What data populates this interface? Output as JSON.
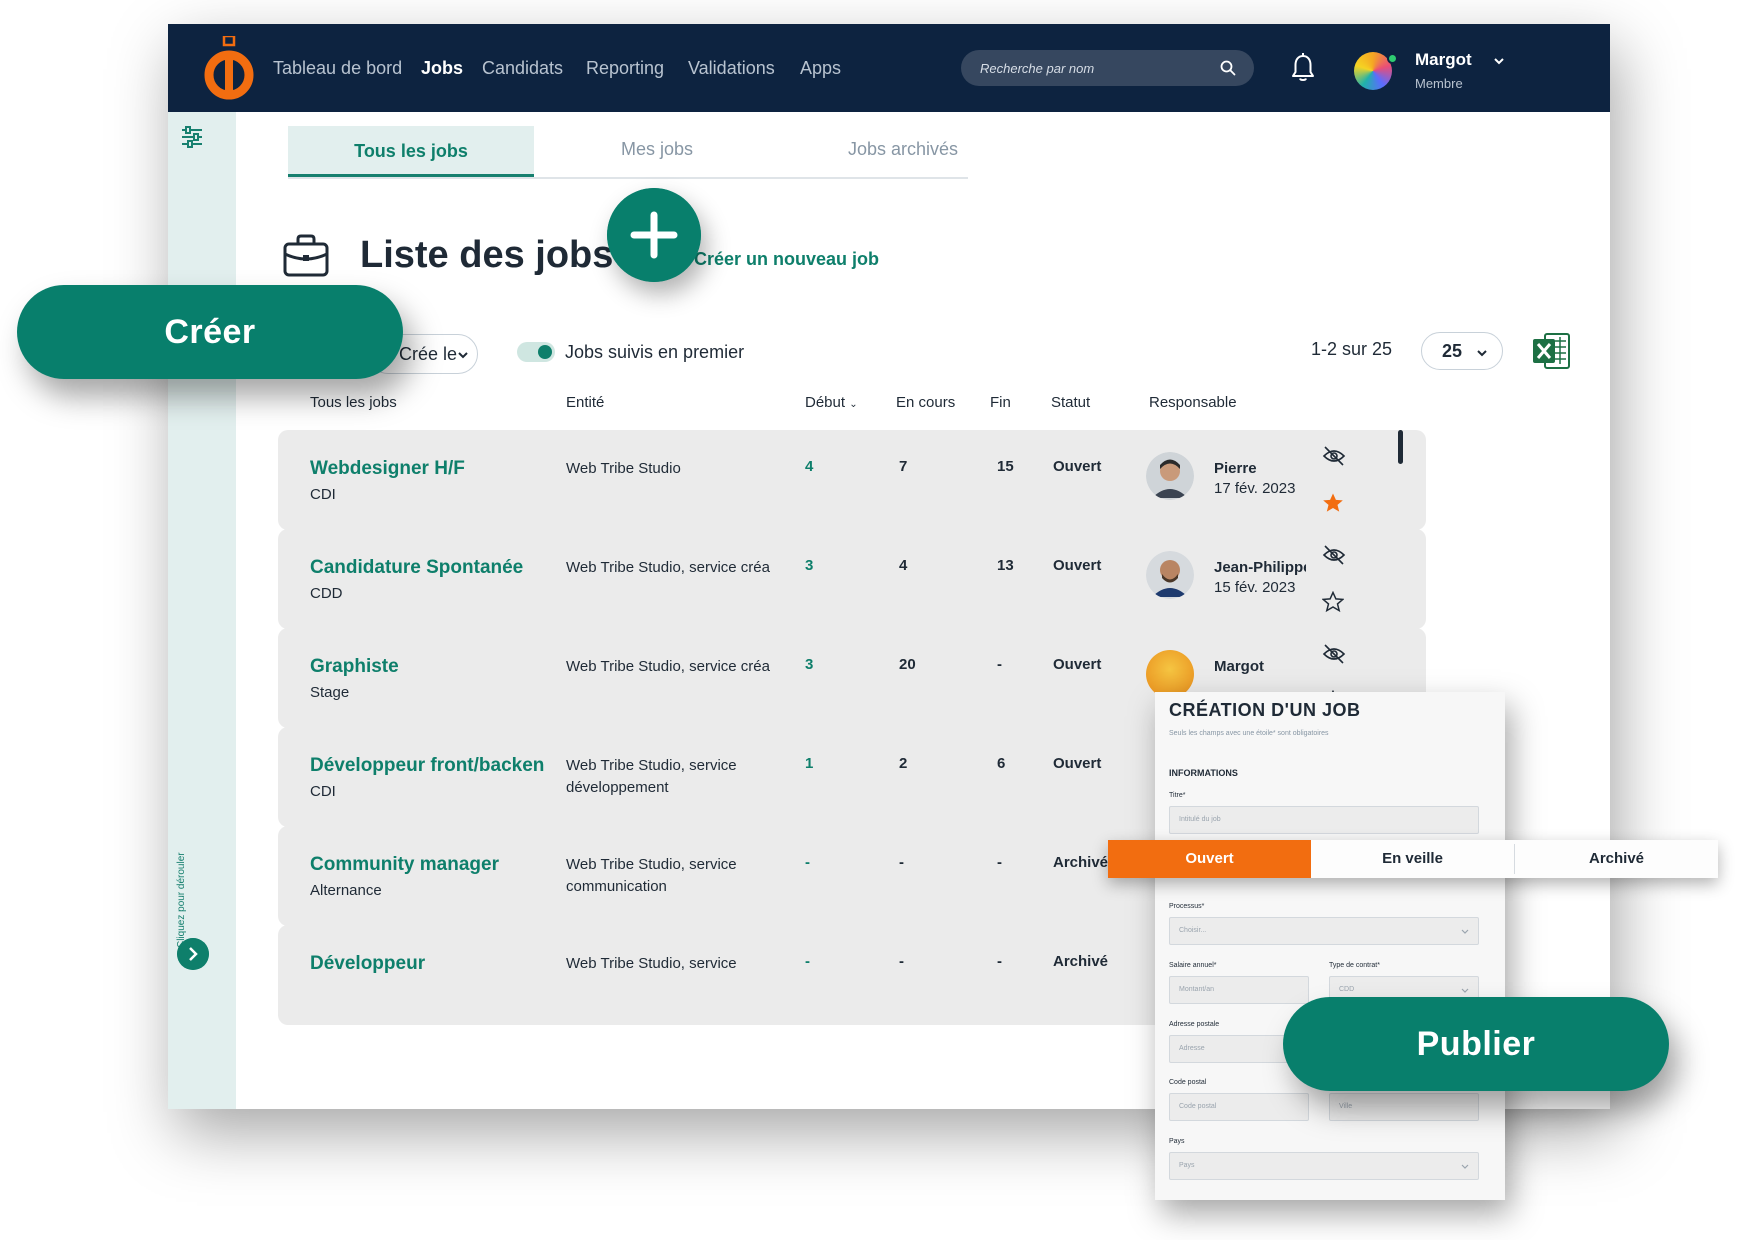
{
  "nav": {
    "items": [
      "Tableau de bord",
      "Jobs",
      "Candidats",
      "Reporting",
      "Validations",
      "Apps"
    ],
    "active": "Jobs"
  },
  "search": {
    "placeholder": "Recherche par nom"
  },
  "user": {
    "name": "Margot",
    "role": "Membre"
  },
  "tabs": [
    "Tous les jobs",
    "Mes jobs",
    "Jobs archivés"
  ],
  "page": {
    "title": "Liste des jobs",
    "create_link": "Créer un nouveau job"
  },
  "filters": {
    "sort_label": "Crée le",
    "toggle_label": "Jobs suivis en premier",
    "pagination": "1-2 sur 25",
    "per_page": "25"
  },
  "table": {
    "headers": {
      "all": "Tous les jobs",
      "entity": "Entité",
      "start": "Début",
      "ongoing": "En cours",
      "end": "Fin",
      "status": "Statut",
      "owner": "Responsable"
    },
    "rows": [
      {
        "title": "Webdesigner H/F",
        "contract": "CDI",
        "entity": "Web Tribe Studio",
        "start": "4",
        "ongoing": "7",
        "end": "15",
        "status": "Ouvert",
        "owner": "Pierre",
        "date": "17 fév. 2023",
        "followed": true
      },
      {
        "title": "Candidature Spontanée",
        "contract": "CDD",
        "entity": "Web Tribe Studio, service créa",
        "start": "3",
        "ongoing": "4",
        "end": "13",
        "status": "Ouvert",
        "owner": "Jean-Philippe",
        "date": "15 fév. 2023",
        "followed": false
      },
      {
        "title": "Graphiste",
        "contract": "Stage",
        "entity": "Web Tribe Studio, service créa",
        "start": "3",
        "ongoing": "20",
        "end": "-",
        "status": "Ouvert",
        "owner": "Margot",
        "date": "",
        "followed": false
      },
      {
        "title": "Développeur front/backen",
        "contract": "CDI",
        "entity": "Web Tribe Studio, service développement",
        "start": "1",
        "ongoing": "2",
        "end": "6",
        "status": "Ouvert",
        "owner": "",
        "date": "",
        "followed": false
      },
      {
        "title": "Community manager",
        "contract": "Alternance",
        "entity": "Web Tribe Studio, service communication",
        "start": "-",
        "ongoing": "-",
        "end": "-",
        "status": "Archivé",
        "owner": "",
        "date": "",
        "followed": false
      },
      {
        "title": "Développeur",
        "contract": "",
        "entity": "Web Tribe Studio, service",
        "start": "-",
        "ongoing": "-",
        "end": "-",
        "status": "Archivé",
        "owner": "",
        "date": "",
        "followed": false
      }
    ]
  },
  "sidebar": {
    "unfold_label": "Cliquez pour dérouler"
  },
  "form": {
    "title": "CRÉATION D'UN JOB",
    "subtitle": "Seuls les champs avec une étoile* sont obligatoires",
    "section": "INFORMATIONS",
    "title_label": "Titre*",
    "title_placeholder": "Intitulé du job",
    "process_label": "Processus*",
    "process_placeholder": "Choisir...",
    "salary_label": "Salaire annuel*",
    "salary_placeholder": "Montant/an",
    "contract_label": "Type de contrat*",
    "contract_placeholder": "CDD",
    "address_label": "Adresse postale",
    "address_placeholder": "Adresse",
    "zip_label": "Code postal",
    "zip_placeholder": "Code postal",
    "city_placeholder": "Ville",
    "country_label": "Pays",
    "country_placeholder": "Pays"
  },
  "status_options": [
    "Ouvert",
    "En veille",
    "Archivé"
  ],
  "callouts": {
    "create": "Créer",
    "publish": "Publier"
  },
  "colors": {
    "navy": "#0d2340",
    "green": "#087f6c",
    "orange": "#f26d10",
    "row_bg": "#ebebeb"
  }
}
